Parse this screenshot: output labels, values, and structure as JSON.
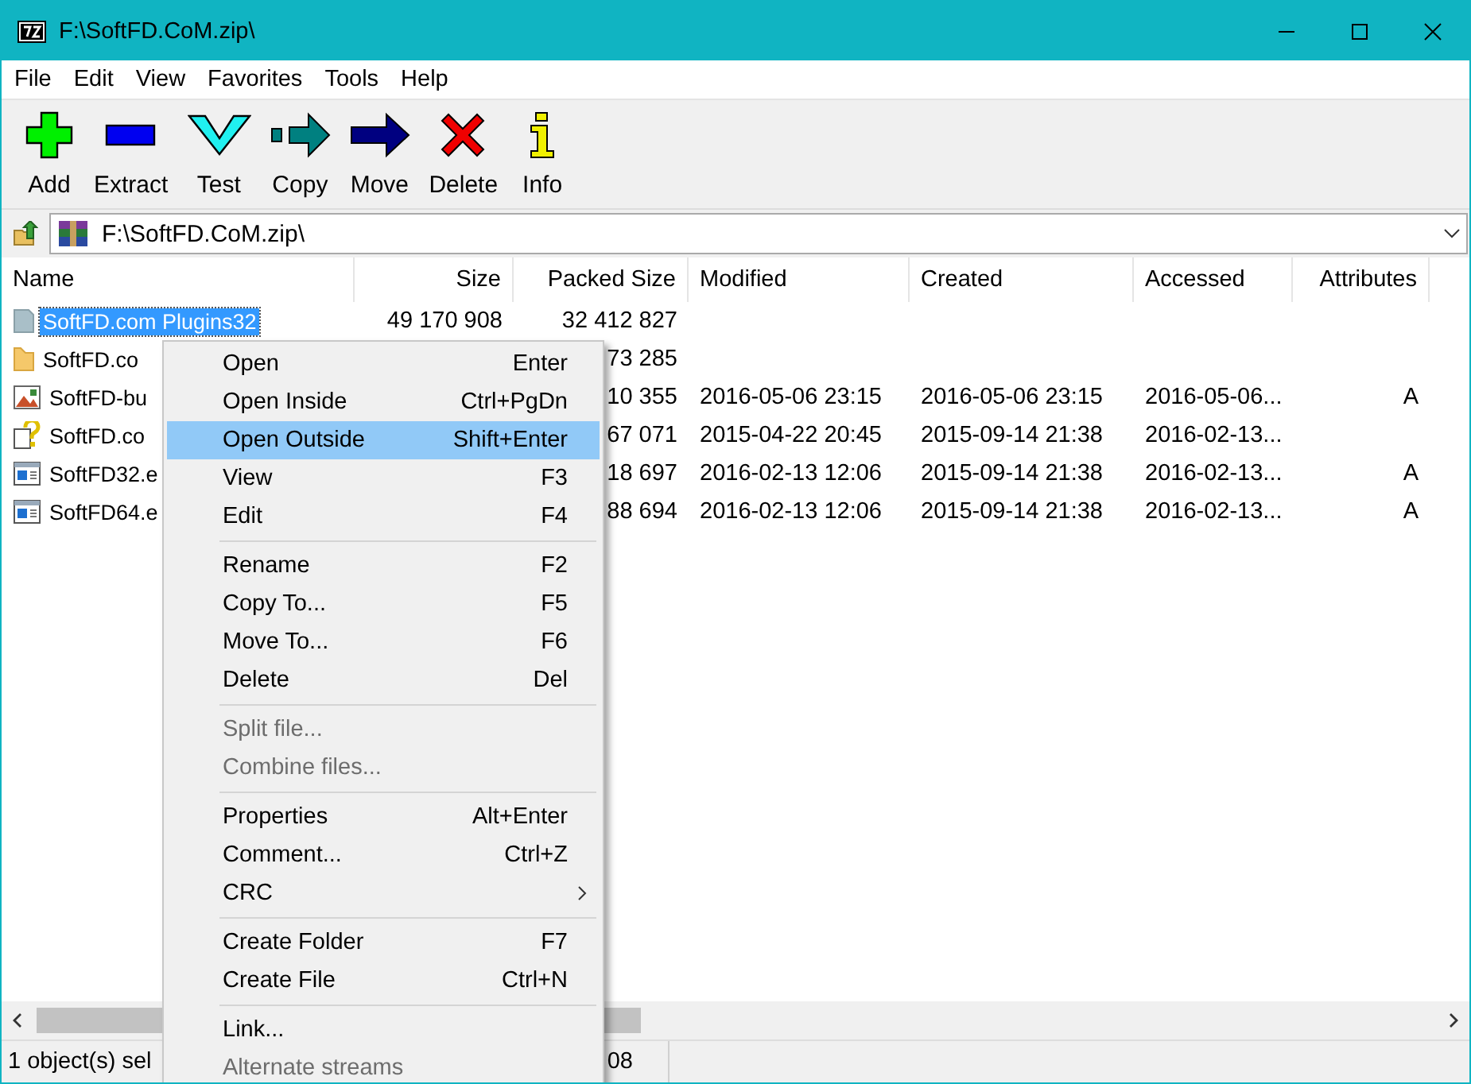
{
  "window": {
    "title": "F:\\SoftFD.CoM.zip\\"
  },
  "menu_bar": [
    "File",
    "Edit",
    "View",
    "Favorites",
    "Tools",
    "Help"
  ],
  "toolbar": [
    {
      "label": "Add",
      "kind": "add"
    },
    {
      "label": "Extract",
      "kind": "extract"
    },
    {
      "label": "Test",
      "kind": "test"
    },
    {
      "label": "Copy",
      "kind": "copy"
    },
    {
      "label": "Move",
      "kind": "move"
    },
    {
      "label": "Delete",
      "kind": "delete"
    },
    {
      "label": "Info",
      "kind": "info"
    }
  ],
  "address": {
    "value": "F:\\SoftFD.CoM.zip\\"
  },
  "table": {
    "columns": [
      "Name",
      "Size",
      "Packed Size",
      "Modified",
      "Created",
      "Accessed",
      "Attributes"
    ],
    "rows": [
      {
        "kind": "folder-grey",
        "selected": true,
        "cells": [
          "SoftFD.com Plugins32",
          "49 170 908",
          "32 412 827",
          "",
          "",
          "",
          ""
        ]
      },
      {
        "kind": "folder",
        "selected": false,
        "cells": [
          "SoftFD.co",
          "",
          "73 285",
          "",
          "",
          "",
          ""
        ]
      },
      {
        "kind": "image",
        "selected": false,
        "cells": [
          "SoftFD-bu",
          "",
          "10 355",
          "2016-05-06 23:15",
          "2016-05-06 23:15",
          "2016-05-06...",
          "A"
        ]
      },
      {
        "kind": "help",
        "selected": false,
        "cells": [
          "SoftFD.co",
          "",
          "67 071",
          "2015-04-22 20:45",
          "2015-09-14 21:38",
          "2016-02-13...",
          ""
        ]
      },
      {
        "kind": "exe",
        "selected": false,
        "cells": [
          "SoftFD32.e",
          "",
          "18 697",
          "2016-02-13 12:06",
          "2015-09-14 21:38",
          "2016-02-13...",
          "A"
        ]
      },
      {
        "kind": "exe",
        "selected": false,
        "cells": [
          "SoftFD64.e",
          "",
          "88 694",
          "2016-02-13 12:06",
          "2015-09-14 21:38",
          "2016-02-13...",
          "A"
        ]
      }
    ]
  },
  "context_menu": [
    {
      "kind": "item",
      "label": "Open",
      "shortcut": "Enter",
      "disabled": false,
      "selected": false
    },
    {
      "kind": "item",
      "label": "Open Inside",
      "shortcut": "Ctrl+PgDn",
      "disabled": false,
      "selected": false
    },
    {
      "kind": "item",
      "label": "Open Outside",
      "shortcut": "Shift+Enter",
      "disabled": false,
      "selected": true
    },
    {
      "kind": "item",
      "label": "View",
      "shortcut": "F3",
      "disabled": false,
      "selected": false
    },
    {
      "kind": "item",
      "label": "Edit",
      "shortcut": "F4",
      "disabled": false,
      "selected": false
    },
    {
      "kind": "separator"
    },
    {
      "kind": "item",
      "label": "Rename",
      "shortcut": "F2",
      "disabled": false,
      "selected": false
    },
    {
      "kind": "item",
      "label": "Copy To...",
      "shortcut": "F5",
      "disabled": false,
      "selected": false
    },
    {
      "kind": "item",
      "label": "Move To...",
      "shortcut": "F6",
      "disabled": false,
      "selected": false
    },
    {
      "kind": "item",
      "label": "Delete",
      "shortcut": "Del",
      "disabled": false,
      "selected": false
    },
    {
      "kind": "separator"
    },
    {
      "kind": "item",
      "label": "Split file...",
      "disabled": true,
      "selected": false
    },
    {
      "kind": "item",
      "label": "Combine files...",
      "disabled": true,
      "selected": false
    },
    {
      "kind": "separator"
    },
    {
      "kind": "item",
      "label": "Properties",
      "shortcut": "Alt+Enter",
      "disabled": false,
      "selected": false
    },
    {
      "kind": "item",
      "label": "Comment...",
      "shortcut": "Ctrl+Z",
      "disabled": false,
      "selected": false
    },
    {
      "kind": "submenu",
      "label": "CRC",
      "disabled": false,
      "selected": false
    },
    {
      "kind": "separator"
    },
    {
      "kind": "item",
      "label": "Create Folder",
      "shortcut": "F7",
      "disabled": false,
      "selected": false
    },
    {
      "kind": "item",
      "label": "Create File",
      "shortcut": "Ctrl+N",
      "disabled": false,
      "selected": false
    },
    {
      "kind": "separator"
    },
    {
      "kind": "item",
      "label": "Link...",
      "disabled": false,
      "selected": false
    },
    {
      "kind": "item",
      "label": "Alternate streams",
      "disabled": true,
      "selected": false
    }
  ],
  "status_bar": [
    "1 object(s) sel",
    "08"
  ]
}
